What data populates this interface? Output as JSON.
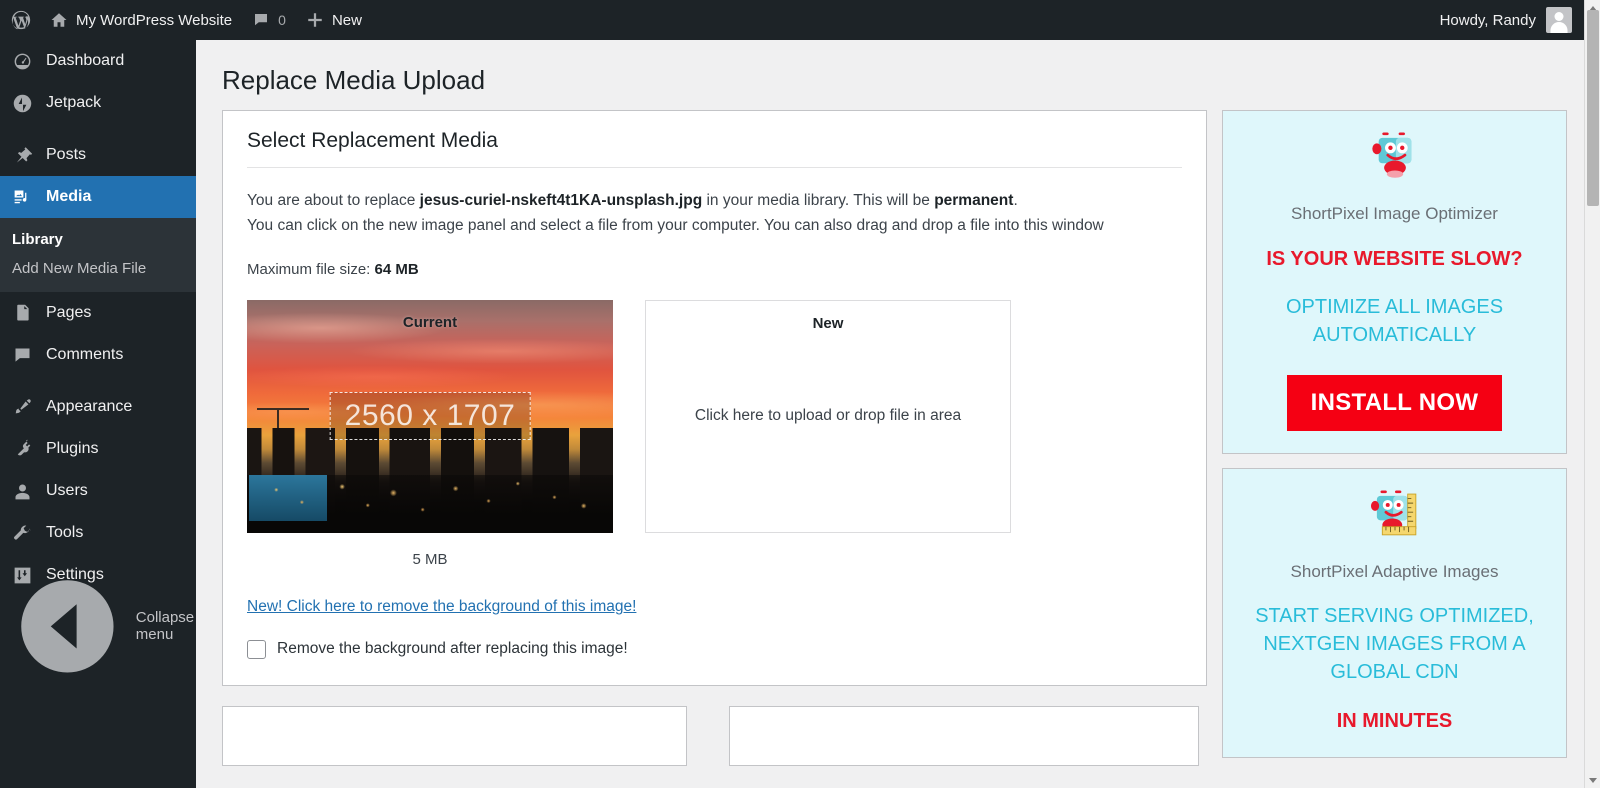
{
  "adminbar": {
    "site_title": "My WordPress Website",
    "comment_count": "0",
    "new_label": "New",
    "howdy": "Howdy, Randy"
  },
  "sidebar": {
    "items": [
      {
        "label": "Dashboard",
        "icon": "dashboard-icon"
      },
      {
        "label": "Jetpack",
        "icon": "jetpack-icon"
      },
      {
        "label": "Posts",
        "icon": "pin-icon"
      },
      {
        "label": "Media",
        "icon": "media-icon"
      },
      {
        "label": "Pages",
        "icon": "pages-icon"
      },
      {
        "label": "Comments",
        "icon": "comments-icon"
      },
      {
        "label": "Appearance",
        "icon": "brush-icon"
      },
      {
        "label": "Plugins",
        "icon": "plug-icon"
      },
      {
        "label": "Users",
        "icon": "user-icon"
      },
      {
        "label": "Tools",
        "icon": "wrench-icon"
      },
      {
        "label": "Settings",
        "icon": "settings-icon"
      }
    ],
    "submenu": [
      {
        "label": "Library",
        "current": true
      },
      {
        "label": "Add New Media File",
        "current": false
      }
    ],
    "collapse_label": "Collapse menu",
    "accent_color": "#2271b1"
  },
  "page": {
    "title": "Replace Media Upload"
  },
  "box": {
    "title": "Select Replacement Media",
    "desc_pre": "You are about to replace ",
    "filename": "jesus-curiel-nskeft4t1KA-unsplash.jpg",
    "desc_mid": " in your media library. This will be ",
    "permanent": "permanent",
    "desc_end": ".",
    "desc_line2": "You can click on the new image panel and select a file from your computer. You can also drag and drop a file into this window",
    "maxsize_label": "Maximum file size: ",
    "maxsize_value": "64 MB"
  },
  "current_media": {
    "label": "Current",
    "dimensions": "2560 x 1707",
    "filesize": "5 MB"
  },
  "new_media": {
    "label": "New",
    "hint": "Click here to upload or drop file in area"
  },
  "background_tools": {
    "link_text": "New! Click here to remove the background of this image!",
    "checkbox_label": "Remove the background after replacing this image!",
    "checked": false
  },
  "promos": [
    {
      "name": "ShortPixel Image Optimizer",
      "headline": "IS YOUR WEBSITE SLOW?",
      "subline": "OPTIMIZE ALL IMAGES AUTOMATICALLY",
      "button": "INSTALL NOW",
      "icon": "robot-icon",
      "bg_color": "#dff7fb",
      "headline_color": "#e8192c",
      "subline_color": "#29bcd9",
      "button_color": "#f50013"
    },
    {
      "name": "ShortPixel Adaptive Images",
      "headline": "",
      "subline": "START SERVING OPTIMIZED, NEXTGEN IMAGES FROM A GLOBAL CDN",
      "trailing": "IN MINUTES",
      "icon": "robot-ruler-icon",
      "bg_color": "#dff7fb",
      "subline_color": "#29bcd9",
      "trailing_color": "#e8192c"
    }
  ]
}
